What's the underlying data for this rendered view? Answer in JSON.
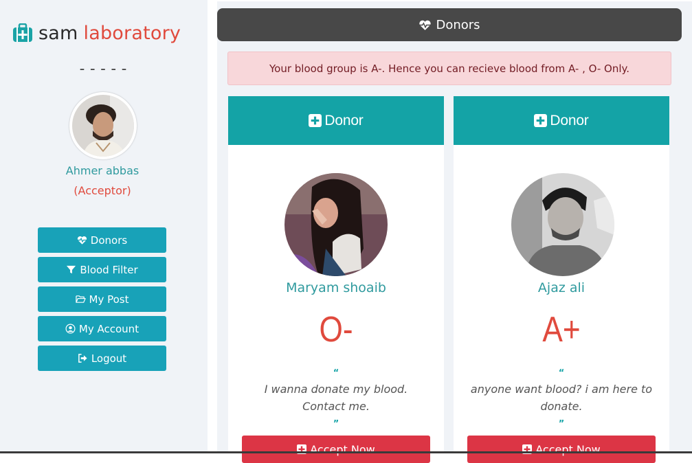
{
  "sidebar": {
    "brand": {
      "word1": "sam",
      "word2": "laboratory",
      "icon": "medkit-icon"
    },
    "divider": "-----",
    "profile": {
      "name": "Ahmer abbas",
      "role": "(Acceptor)"
    },
    "nav": [
      {
        "label": "Donors",
        "icon": "heartbeat-icon"
      },
      {
        "label": "Blood Filter",
        "icon": "filter-icon"
      },
      {
        "label": "My Post",
        "icon": "folder-open-icon"
      },
      {
        "label": "My Account",
        "icon": "user-circle-icon"
      },
      {
        "label": "Logout",
        "icon": "sign-out-icon"
      }
    ]
  },
  "main": {
    "header_title": "Donors",
    "alert": "Your blood group is A-. Hence you can recieve blood from A- , O- Only.",
    "cards": [
      {
        "head_label": "Donor",
        "name": "Maryam shoaib",
        "blood": "O-",
        "quote": "I wanna donate my blood. Contact me.",
        "accept_label": "Accept Now"
      },
      {
        "head_label": "Donor",
        "name": "Ajaz ali",
        "blood": "A+",
        "quote": "anyone want blood? i am here to donate.",
        "accept_label": "Accept Now"
      }
    ],
    "quote_open": "“",
    "quote_close": "”"
  },
  "colors": {
    "teal": "#14a3a6",
    "nav_blue": "#18a2b8",
    "red": "#e04a3d",
    "danger": "#dc3545",
    "header_dark": "#484848",
    "alert_bg": "#f8d7da"
  }
}
